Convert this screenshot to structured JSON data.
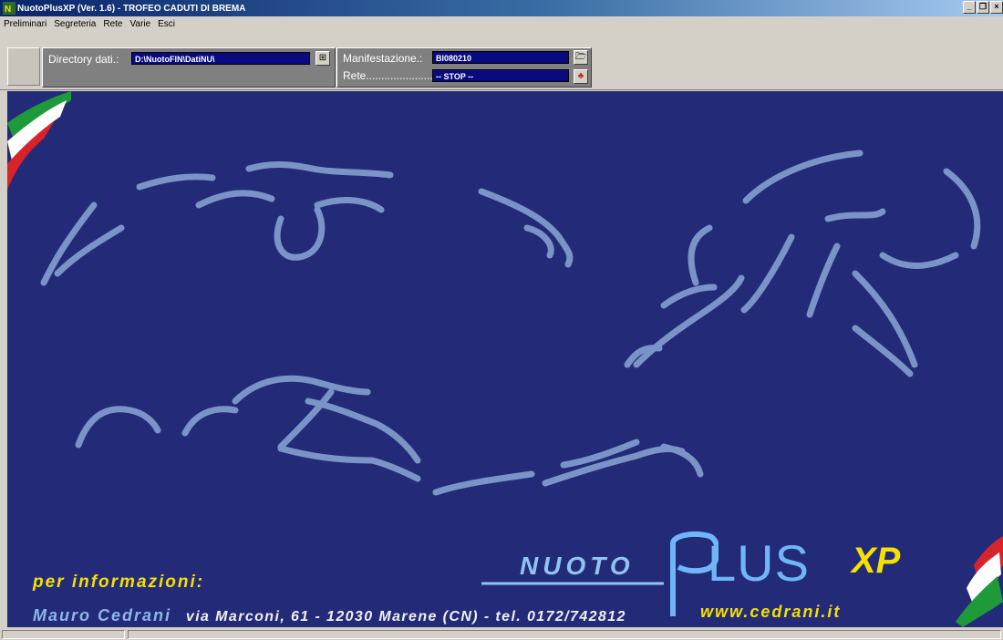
{
  "window": {
    "title": "NuotoPlusXP (Ver. 1.6) - TROFEO CADUTI DI BREMA",
    "icon": "app-icon"
  },
  "menu": [
    "Preliminari",
    "Segreteria",
    "Rete",
    "Varie",
    "Esci"
  ],
  "toolbar": {
    "directory_label": "Directory dati.:",
    "directory_value": "D:\\NuotoFIN\\DatiNU\\",
    "manifestazione_label": "Manifestazione.:",
    "manifestazione_value": "BI080210",
    "rete_label": "Rete.........................:",
    "rete_value": "-- STOP --"
  },
  "banner": {
    "logo_nuoto": "NUOTO",
    "logo_plus": "LUS",
    "logo_xp": "XP",
    "info_heading": "per informazioni:",
    "contact_name": "Mauro Cedrani",
    "contact_address": "via Marconi, 61 - 12030 Marene (CN) - tel. 0172/742812",
    "website": "www.cedrani.it"
  },
  "colors": {
    "background": "#232b78",
    "swimmer_strokes": "#7b94c8",
    "accent_yellow": "#f5e000",
    "titlebar": "#0a246a",
    "flag_green": "#1e9a3a",
    "flag_red": "#d8232a"
  }
}
